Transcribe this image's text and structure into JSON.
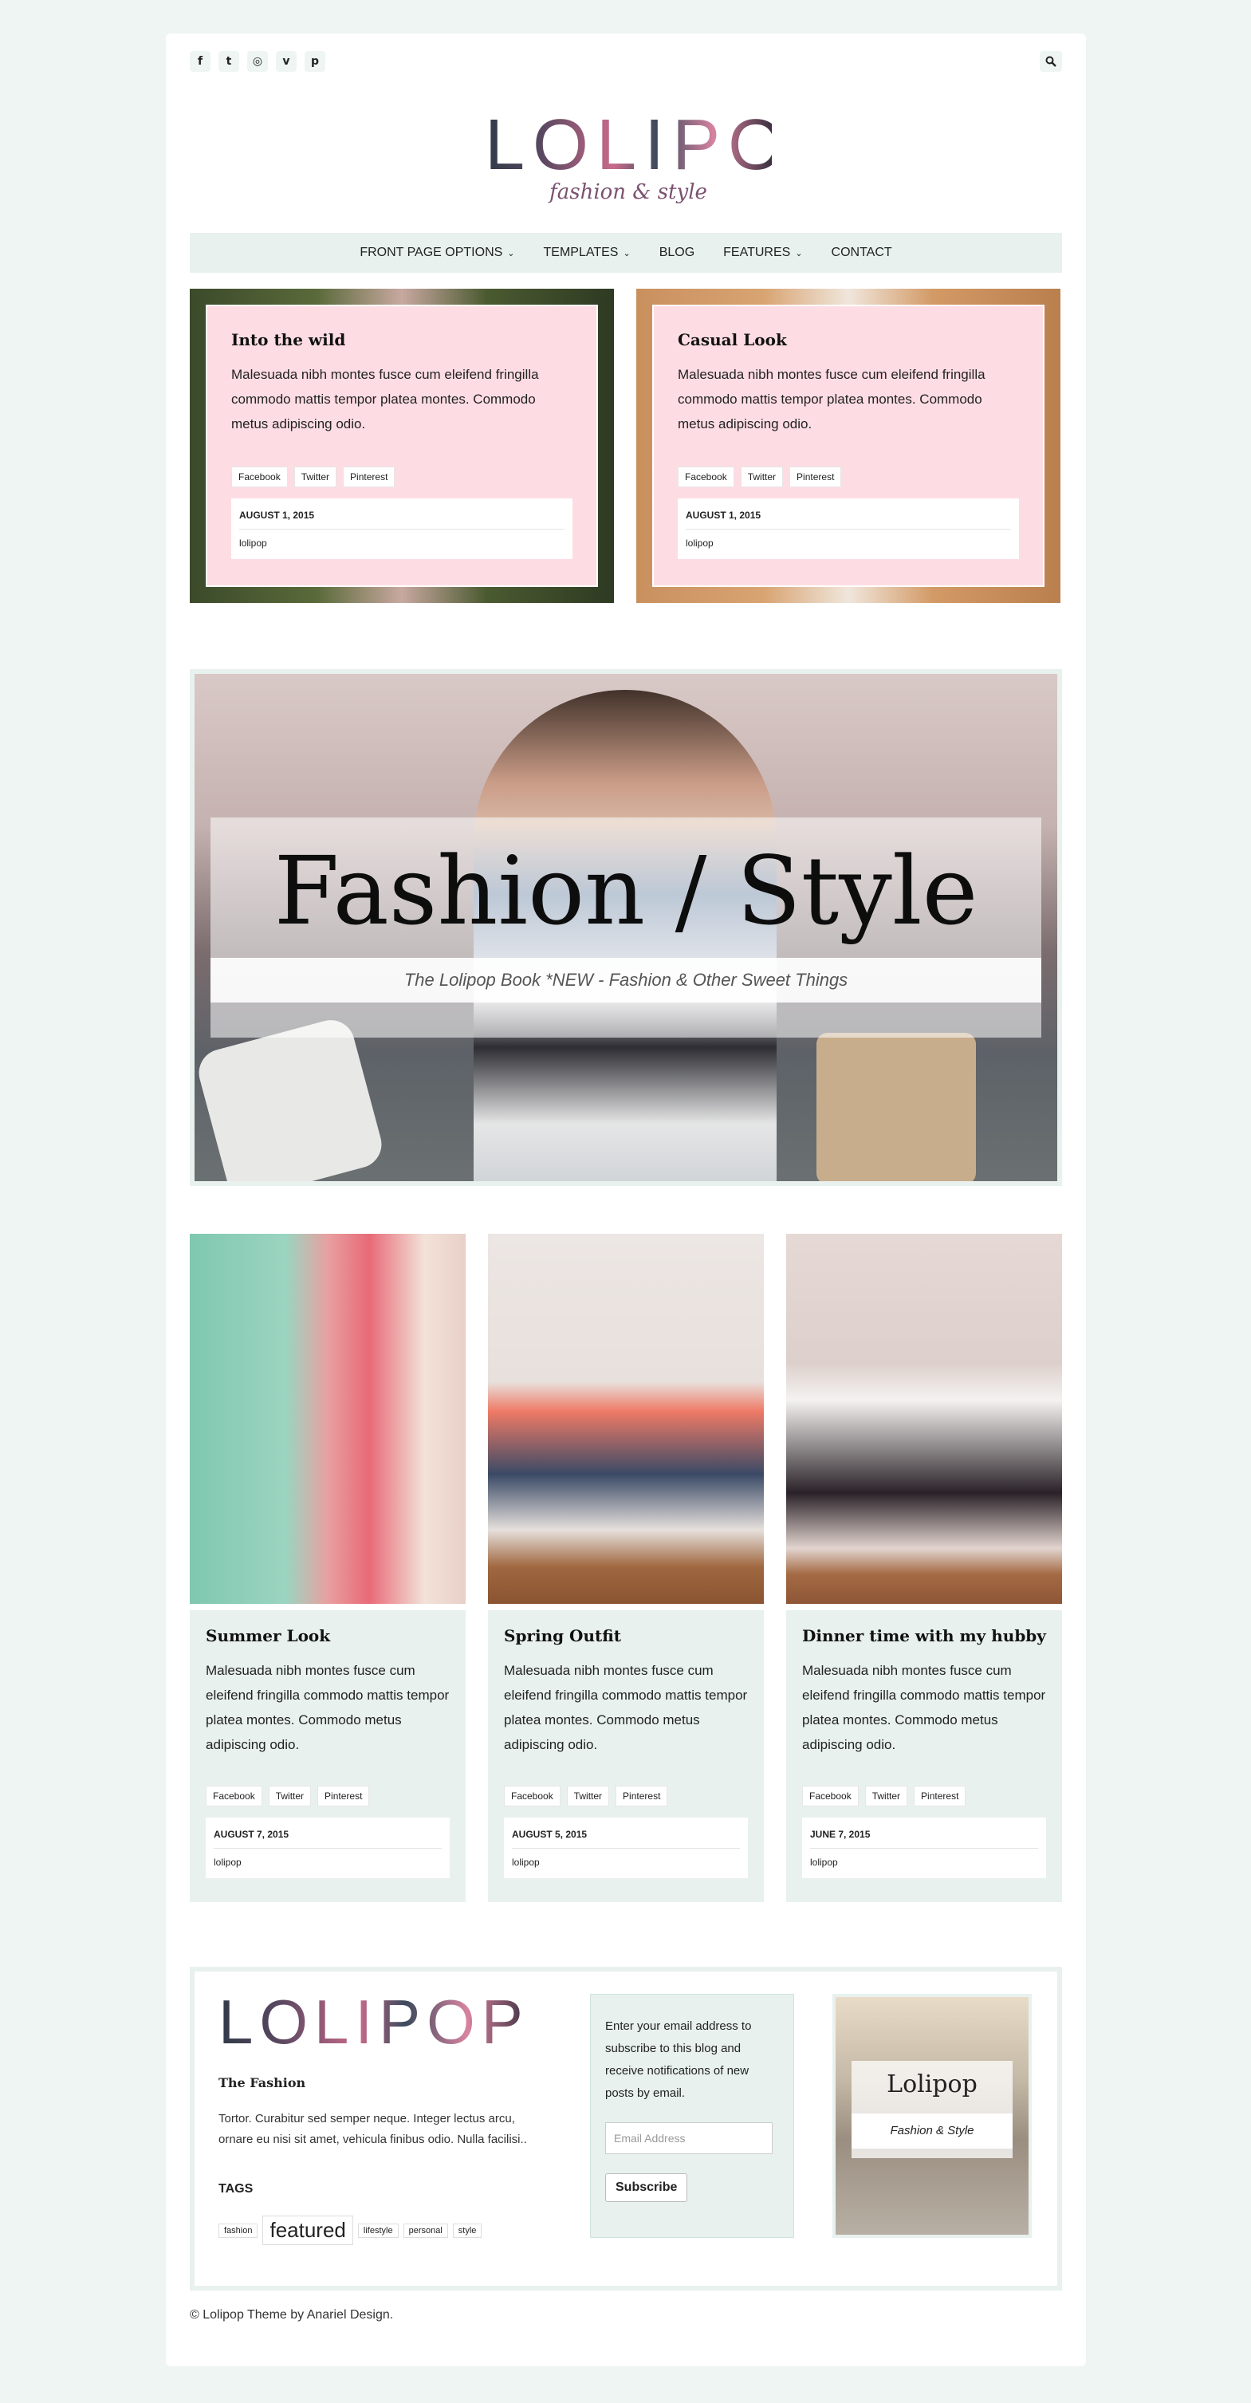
{
  "social": [
    "f",
    "t",
    "◎",
    "v",
    "p"
  ],
  "logo": {
    "word": "LOLIPOP",
    "tagline": "fashion & style"
  },
  "nav": [
    {
      "label": "FRONT PAGE OPTIONS",
      "caret": true
    },
    {
      "label": "TEMPLATES",
      "caret": true
    },
    {
      "label": "BLOG",
      "caret": false
    },
    {
      "label": "FEATURES",
      "caret": true
    },
    {
      "label": "CONTACT",
      "caret": false
    }
  ],
  "share_labels": [
    "Facebook",
    "Twitter",
    "Pinterest"
  ],
  "top_posts": [
    {
      "title": "Into the wild",
      "excerpt": "Malesuada nibh montes fusce cum eleifend fringilla commodo mattis tempor platea montes. Commodo metus adipiscing odio.",
      "date": "AUGUST 1, 2015",
      "author": "lolipop"
    },
    {
      "title": "Casual Look",
      "excerpt": "Malesuada nibh montes fusce cum eleifend fringilla commodo mattis tempor platea montes. Commodo metus adipiscing odio.",
      "date": "AUGUST 1, 2015",
      "author": "lolipop"
    }
  ],
  "hero": {
    "title": "Fashion / Style",
    "subtitle": "The Lolipop Book *NEW - Fashion & Other Sweet Things"
  },
  "grid_posts": [
    {
      "title": "Summer Look",
      "excerpt": "Malesuada nibh montes fusce cum eleifend fringilla commodo mattis tempor platea montes. Commodo metus adipiscing odio.",
      "date": "AUGUST 7, 2015",
      "author": "lolipop"
    },
    {
      "title": "Spring Outfit",
      "excerpt": "Malesuada nibh montes fusce cum eleifend fringilla commodo mattis tempor platea montes. Commodo metus adipiscing odio.",
      "date": "AUGUST 5, 2015",
      "author": "lolipop"
    },
    {
      "title": "Dinner time with my hubby",
      "excerpt": "Malesuada nibh montes fusce cum eleifend fringilla commodo mattis tempor platea montes. Commodo metus adipiscing odio.",
      "date": "JUNE 7, 2015",
      "author": "lolipop"
    }
  ],
  "footer": {
    "logo_word": "LOLIPOP",
    "heading": "The Fashion",
    "text": "Tortor. Curabitur sed semper neque. Integer lectus arcu, ornare eu nisi sit amet, vehicula finibus odio. Nulla facilisi..",
    "tags_title": "TAGS",
    "tags": [
      "fashion",
      "featured",
      "lifestyle",
      "personal",
      "style"
    ],
    "subscribe_text": "Enter your email address to subscribe to this blog and receive notifications of new posts by email.",
    "email_placeholder": "Email Address",
    "subscribe_button": "Subscribe",
    "image_title": "Lolipop",
    "image_sub": "Fashion & Style"
  },
  "copyright": "© Lolipop Theme by Anariel Design."
}
